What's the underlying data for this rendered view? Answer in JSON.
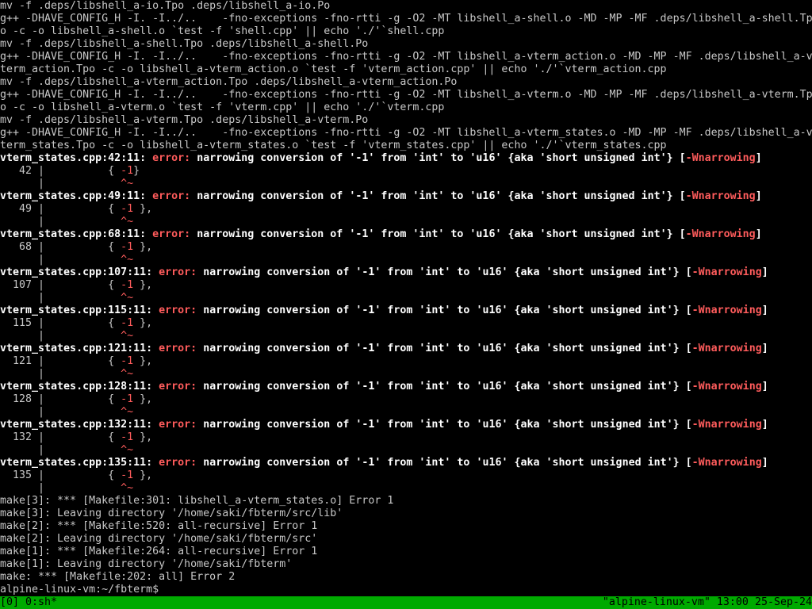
{
  "terminal": {
    "build_lines": [
      "mv -f .deps/libshell_a-io.Tpo .deps/libshell_a-io.Po",
      "g++ -DHAVE_CONFIG_H -I. -I../..    -fno-exceptions -fno-rtti -g -O2 -MT libshell_a-shell.o -MD -MP -MF .deps/libshell_a-shell.Tp",
      "o -c -o libshell_a-shell.o `test -f 'shell.cpp' || echo './'`shell.cpp",
      "mv -f .deps/libshell_a-shell.Tpo .deps/libshell_a-shell.Po",
      "g++ -DHAVE_CONFIG_H -I. -I../..    -fno-exceptions -fno-rtti -g -O2 -MT libshell_a-vterm_action.o -MD -MP -MF .deps/libshell_a-v",
      "term_action.Tpo -c -o libshell_a-vterm_action.o `test -f 'vterm_action.cpp' || echo './'`vterm_action.cpp",
      "mv -f .deps/libshell_a-vterm_action.Tpo .deps/libshell_a-vterm_action.Po",
      "g++ -DHAVE_CONFIG_H -I. -I../..    -fno-exceptions -fno-rtti -g -O2 -MT libshell_a-vterm.o -MD -MP -MF .deps/libshell_a-vterm.Tp",
      "o -c -o libshell_a-vterm.o `test -f 'vterm.cpp' || echo './'`vterm.cpp",
      "mv -f .deps/libshell_a-vterm.Tpo .deps/libshell_a-vterm.Po",
      "g++ -DHAVE_CONFIG_H -I. -I../..    -fno-exceptions -fno-rtti -g -O2 -MT libshell_a-vterm_states.o -MD -MP -MF .deps/libshell_a-v",
      "term_states.Tpo -c -o libshell_a-vterm_states.o `test -f 'vterm_states.cpp' || echo './'`vterm_states.cpp"
    ],
    "error_label": "error:",
    "error_message": " narrowing conversion of '-1' from 'int' to 'u16' {aka 'short unsigned int'} ",
    "warning_flag": "-Wnarrowing",
    "minus_one": "-1",
    "carets": "^~",
    "errors": [
      {
        "location": "vterm_states.cpp:42:11:",
        "line_no": "42",
        "code_pre": "{ ",
        "code_post": "}"
      },
      {
        "location": "vterm_states.cpp:49:11:",
        "line_no": "49",
        "code_pre": "{ ",
        "code_post": " },"
      },
      {
        "location": "vterm_states.cpp:68:11:",
        "line_no": "68",
        "code_pre": "{ ",
        "code_post": " },"
      },
      {
        "location": "vterm_states.cpp:107:11:",
        "line_no": "107",
        "code_pre": "{ ",
        "code_post": " },"
      },
      {
        "location": "vterm_states.cpp:115:11:",
        "line_no": "115",
        "code_pre": "{ ",
        "code_post": " },"
      },
      {
        "location": "vterm_states.cpp:121:11:",
        "line_no": "121",
        "code_pre": "{ ",
        "code_post": " },"
      },
      {
        "location": "vterm_states.cpp:128:11:",
        "line_no": "128",
        "code_pre": "{ ",
        "code_post": " },"
      },
      {
        "location": "vterm_states.cpp:132:11:",
        "line_no": "132",
        "code_pre": "{ ",
        "code_post": " },"
      },
      {
        "location": "vterm_states.cpp:135:11:",
        "line_no": "135",
        "code_pre": "{ ",
        "code_post": " },"
      }
    ],
    "make_lines": [
      "make[3]: *** [Makefile:301: libshell_a-vterm_states.o] Error 1",
      "make[3]: Leaving directory '/home/saki/fbterm/src/lib'",
      "make[2]: *** [Makefile:520: all-recursive] Error 1",
      "make[2]: Leaving directory '/home/saki/fbterm/src'",
      "make[1]: *** [Makefile:264: all-recursive] Error 1",
      "make[1]: Leaving directory '/home/saki/fbterm'",
      "make: *** [Makefile:202: all] Error 2"
    ],
    "prompt": "alpine-linux-vm:~/fbterm$"
  },
  "statusbar": {
    "window_list": "[0] 0:sh*",
    "host": "\"alpine-linux-vm\" 13:00 25-Sep-24",
    "bg_color": "#00aa00",
    "fg_color": "#000000"
  },
  "colors": {
    "background": "#000000",
    "text": "#c8c8c8",
    "bold_text": "#ffffff",
    "error": "#ff5c5c"
  }
}
